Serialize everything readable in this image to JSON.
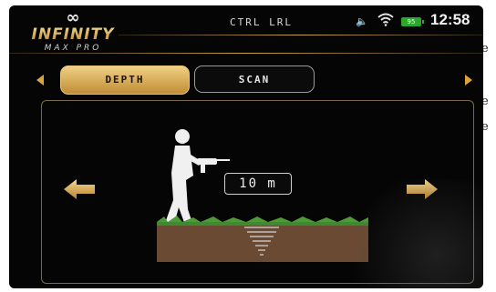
{
  "side_text": [
    "e",
    "e",
    "e"
  ],
  "header": {
    "logo_symbol": "∞",
    "brand": "INFINITY",
    "model": "MAX PRO",
    "title": "CTRL LRL",
    "battery_level": "95",
    "time": "12:58"
  },
  "tabs": [
    {
      "label": "DEPTH",
      "active": true
    },
    {
      "label": "SCAN",
      "active": false
    }
  ],
  "depth_readout": "10 m",
  "icons": [
    "speaker-icon",
    "wifi-icon",
    "battery-icon",
    "left-arrow-icon",
    "right-arrow-icon",
    "person-detector-icon",
    "ground-layer-icon"
  ],
  "colors": {
    "accent_gold": "#d8a63d",
    "background": "#050505",
    "soil": "#6a4a32",
    "grass": "#3e8a2e",
    "battery": "#2ba82b"
  }
}
